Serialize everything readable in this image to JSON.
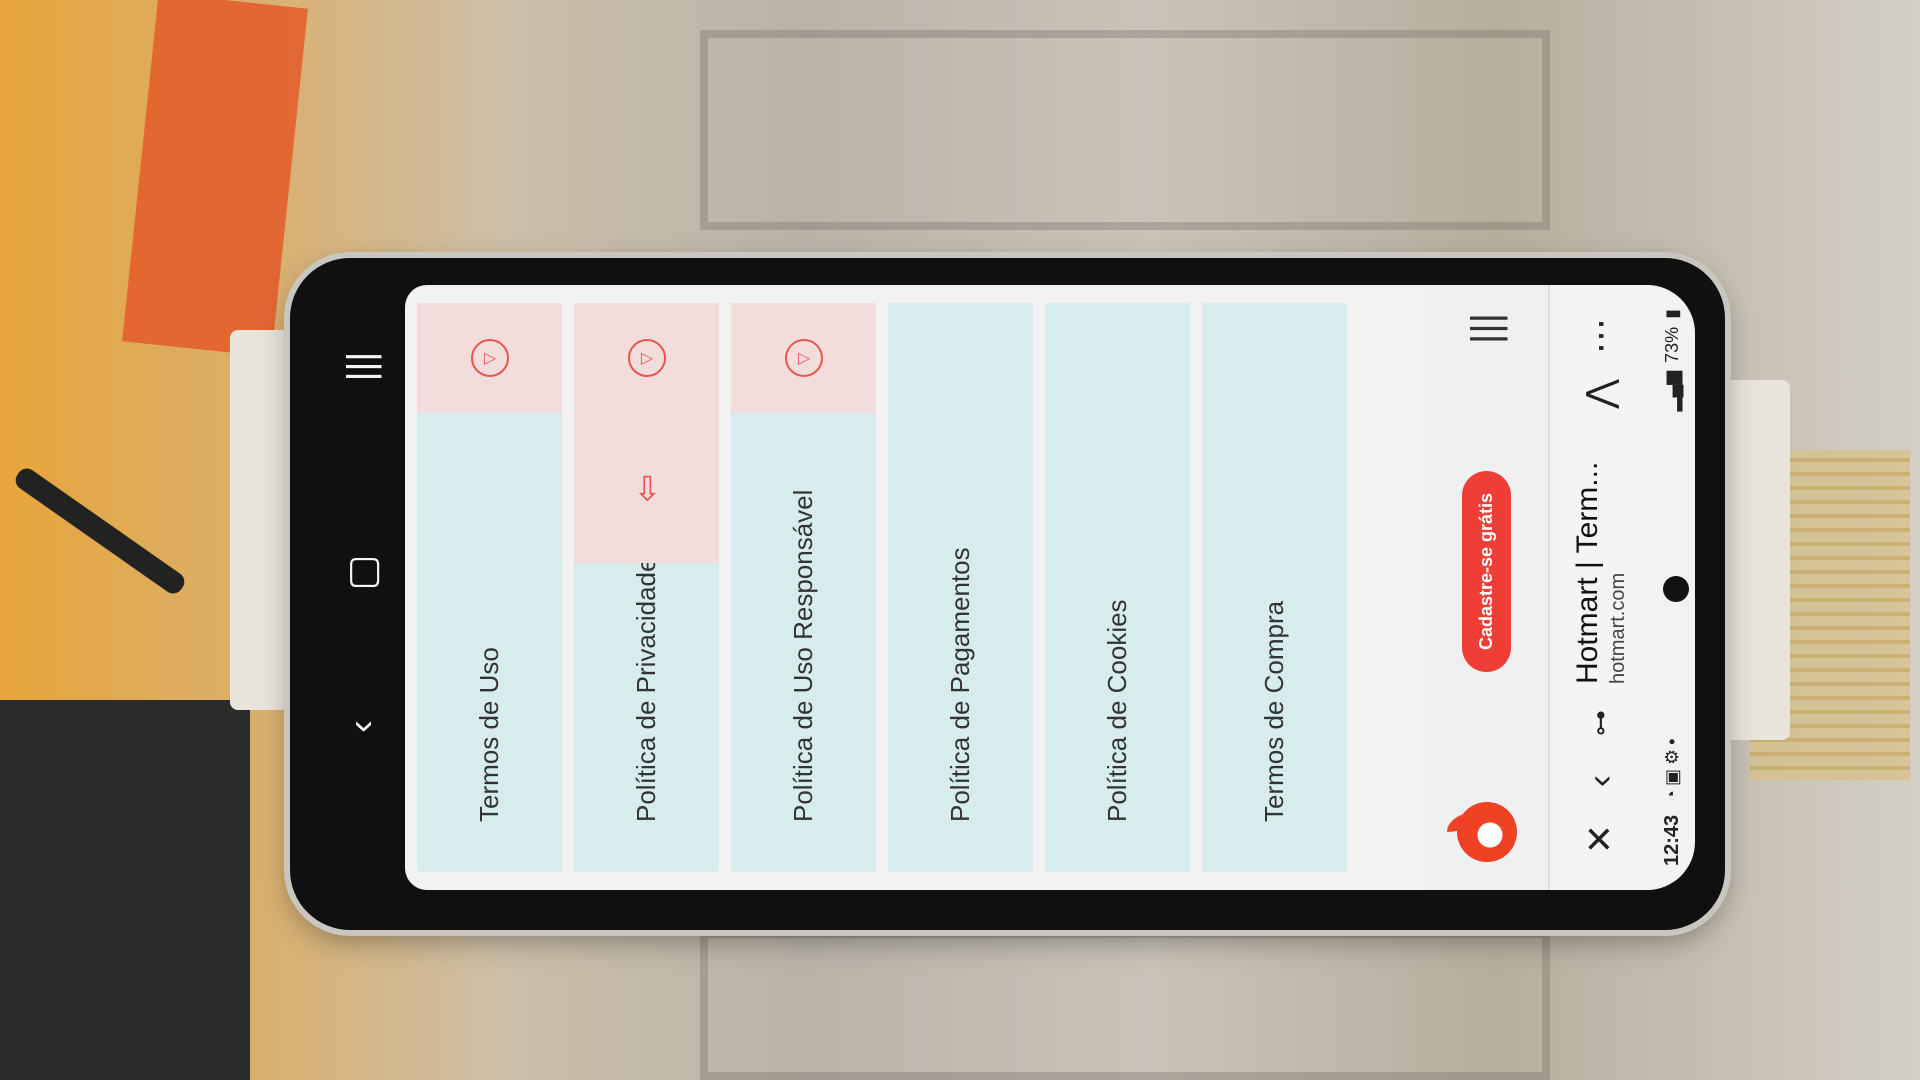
{
  "status_bar": {
    "time": "12:43",
    "battery": "73%"
  },
  "browser": {
    "title": "Hotmart | Term...",
    "url": "hotmart.com"
  },
  "site_header": {
    "cta_label": "Cadastre-se grátis"
  },
  "terms": [
    {
      "label": "Termos de Uso"
    },
    {
      "label": "Política de Privacidade"
    },
    {
      "label": "Política de Uso Responsável"
    },
    {
      "label": "Política de Pagamentos"
    },
    {
      "label": "Política de Cookies"
    },
    {
      "label": "Termos de Compra"
    }
  ]
}
